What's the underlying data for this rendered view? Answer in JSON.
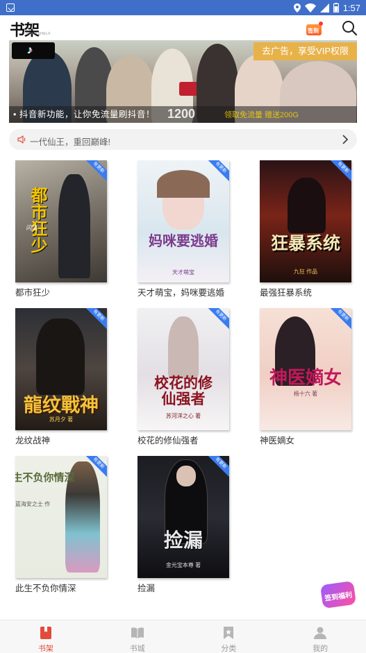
{
  "status_bar": {
    "time": "1:57"
  },
  "header": {
    "logo": "书架",
    "logo_sub": "BOOKSHELF",
    "gift_label": "签到"
  },
  "banner": {
    "vip_tag": "去广告，享受VIP权限",
    "caption": "• 抖音新功能，让你免流量刷抖音！",
    "big_text": "1200",
    "tail_text": "领取免流量 赠送200G"
  },
  "notice": {
    "text": "一代仙王，重回巅峰!"
  },
  "books": [
    {
      "title": "都市狂少",
      "cover_text": "都市狂少",
      "cover_author": "闪蒲",
      "badge": "有更新"
    },
    {
      "title": "天才萌宝，妈咪要逃婚",
      "cover_text": "妈咪要逃婚",
      "cover_author": "天才萌宝",
      "badge": "有更新"
    },
    {
      "title": "最强狂暴系统",
      "cover_text": "狂暴系统",
      "cover_author": "九狂 作品",
      "badge": "有更新"
    },
    {
      "title": "龙纹战神",
      "cover_text": "龍纹戰神",
      "cover_author": "苏月夕 著",
      "badge": "有更新"
    },
    {
      "title": "校花的修仙强者",
      "cover_text": "校花的修仙强者",
      "cover_author": "苏河洋之心 著",
      "badge": "有更新"
    },
    {
      "title": "神医嫡女",
      "cover_text": "神医嫡女",
      "cover_author": "杨十六 著",
      "badge": "有更新"
    },
    {
      "title": "此生不负你情深",
      "cover_text": "此生不负你情深",
      "cover_author": "蓝海安之士 作",
      "badge": "有更新"
    },
    {
      "title": "捡漏",
      "cover_text": "捡漏",
      "cover_author": "金元宝本尊 著",
      "badge": "有更新"
    }
  ],
  "float_badge": {
    "label": "签到福利"
  },
  "bottom_nav": [
    {
      "label": "书架",
      "active": true
    },
    {
      "label": "书城",
      "active": false
    },
    {
      "label": "分类",
      "active": false
    },
    {
      "label": "我的",
      "active": false
    }
  ]
}
